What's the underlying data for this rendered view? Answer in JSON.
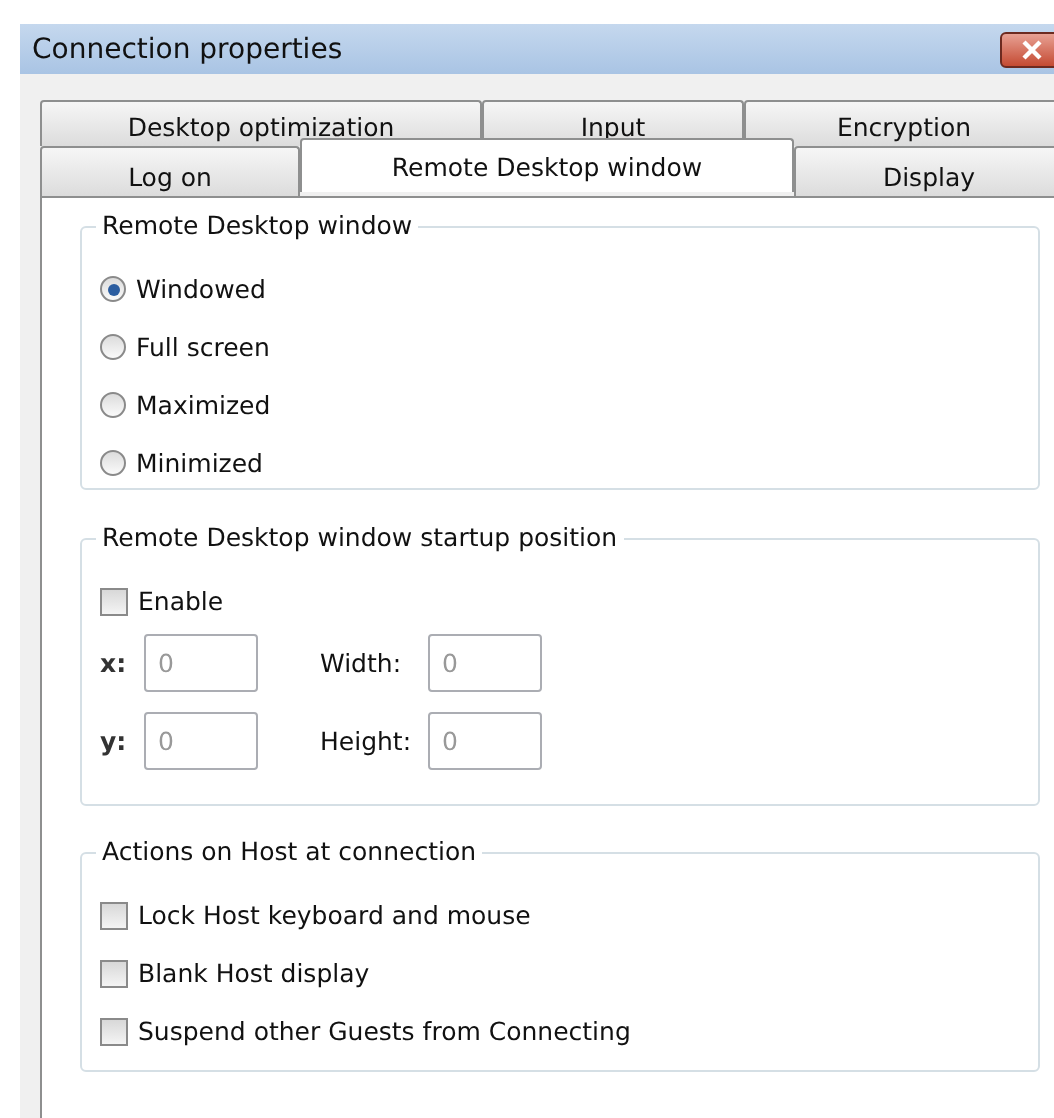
{
  "window": {
    "title": "Connection properties"
  },
  "tab_rows": [
    {
      "tabs": [
        {
          "label": "Desktop optimization",
          "selected": false
        },
        {
          "label": "Input",
          "selected": false
        },
        {
          "label": "Encryption",
          "selected": false
        }
      ]
    },
    {
      "tabs": [
        {
          "label": "Log on",
          "selected": false
        },
        {
          "label": "Remote Desktop window",
          "selected": true
        },
        {
          "label": "Display",
          "selected": false
        }
      ]
    }
  ],
  "groups": [
    {
      "kind": "radios",
      "title": "Remote Desktop window",
      "options": [
        {
          "label": "Windowed",
          "selected": true
        },
        {
          "label": "Full screen",
          "selected": false
        },
        {
          "label": "Maximized",
          "selected": false
        },
        {
          "label": "Minimized",
          "selected": false
        }
      ]
    },
    {
      "kind": "position",
      "title": "Remote Desktop window startup position",
      "enable": {
        "label": "Enable",
        "checked": false
      },
      "fields": [
        {
          "label": "x:",
          "value": "0",
          "disabled": true
        },
        {
          "label": "Width:",
          "value": "0",
          "disabled": true
        },
        {
          "label": "y:",
          "value": "0",
          "disabled": true
        },
        {
          "label": "Height:",
          "value": "0",
          "disabled": true
        }
      ]
    },
    {
      "kind": "checks",
      "title": "Actions on Host at connection",
      "options": [
        {
          "label": "Lock Host keyboard and mouse",
          "checked": false
        },
        {
          "label": "Blank Host display",
          "checked": false
        },
        {
          "label": "Suspend other Guests from Connecting",
          "checked": false
        }
      ]
    }
  ]
}
